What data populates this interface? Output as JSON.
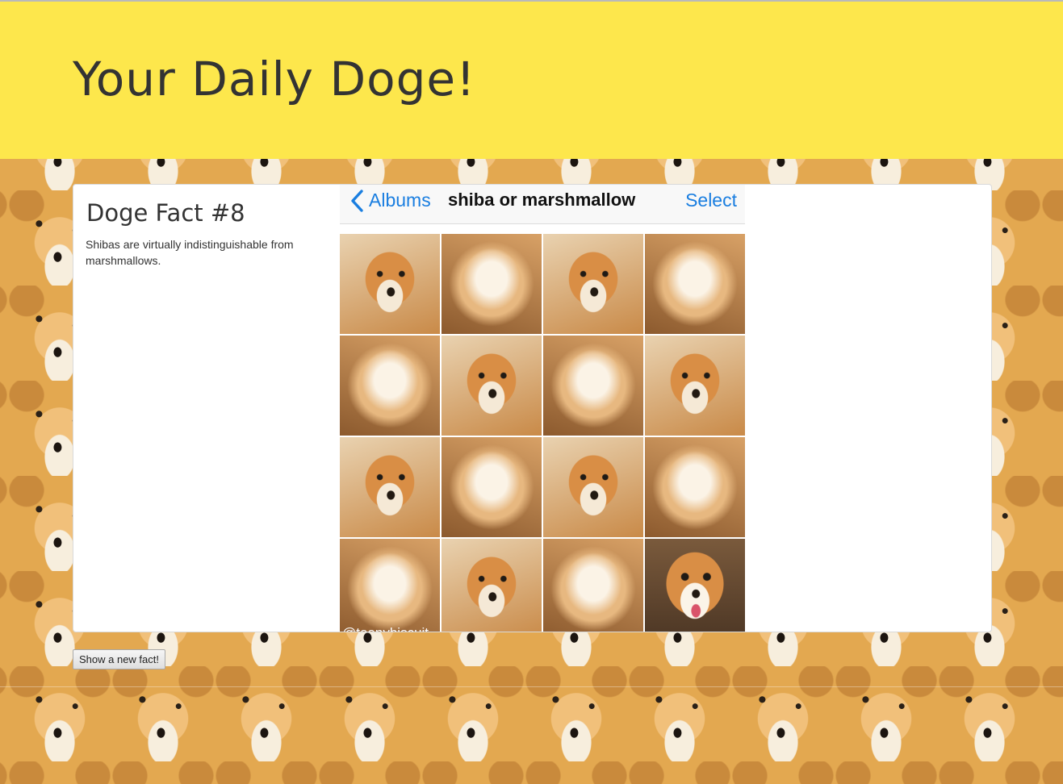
{
  "header": {
    "title": "Your Daily Doge!",
    "background_color": "#fde74c"
  },
  "fact": {
    "title": "Doge Fact #8",
    "text": "Shibas are virtually indistinguishable from marshmallows."
  },
  "fact_image": {
    "navbar": {
      "back_label": "Albums",
      "title": "shiba or marshmallow",
      "select_label": "Select"
    },
    "watermark": "@teenybiscuit",
    "grid": [
      "shiba",
      "mallow",
      "shiba",
      "mallow",
      "mallow",
      "shiba",
      "mallow",
      "shiba",
      "shiba",
      "mallow",
      "shiba",
      "mallow",
      "mallow",
      "shiba",
      "mallow",
      "shiba-smile"
    ]
  },
  "button": {
    "label": "Show a new fact!"
  },
  "colors": {
    "accent": "#1a7ee0",
    "text": "#333333"
  }
}
